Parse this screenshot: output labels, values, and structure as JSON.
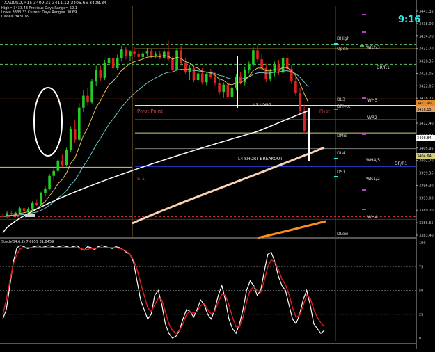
{
  "window": {
    "title": "XAUUSD,M15"
  },
  "header": {
    "ohlc": "XAUUSD,M15  3409.31 3411.12 3405.66 3408.84",
    "info_lines": [
      "High= 3433.43   Previous Days Range= 50.1",
      "Low= 3383.33   Current Days Range= 30.69",
      "Close= 3431.89"
    ]
  },
  "clock": "9:16",
  "colors": {
    "background": "#000000",
    "bull_candle": "#22cc22",
    "bear_candle": "#dd2222",
    "ema_fast": "#e8c04a",
    "ema_mid": "#6fc9c9",
    "ema_slow": "#ffffff",
    "ma_peach": "#f7d2b5",
    "ma_orange": "#ff8c1a",
    "stoch_main": "#ffffff",
    "stoch_signal": "#d81e1e",
    "current_price_tag": "#ff8c1a"
  },
  "price_axis": {
    "labels": [
      "3441.35",
      "3438.00",
      "3434.70",
      "3431.70",
      "3428.35",
      "3425.05",
      "3422.05",
      "3418.75",
      "3415.45",
      "3412.40",
      "3408.84",
      "3405.95",
      "3402.70",
      "3399.35",
      "3396.30",
      "3393.00",
      "3389.70",
      "3386.65",
      "3383.40"
    ],
    "tags": [
      "3417.90",
      "3416.15",
      "3404.64"
    ]
  },
  "stoch": {
    "label": "Stoch(34,6,2) 7.6659 31.8459",
    "levels": [
      "100",
      "75",
      "50",
      "25",
      "0"
    ]
  },
  "annotations": {
    "pivot_point": "Pivot Point",
    "s1": "S 1",
    "l3_long": "L3 LONG",
    "l4_short_breakout": "L4 SHORT BREAKOUT",
    "pivot": "Pivot"
  },
  "levels": {
    "dhigh": "DHigh",
    "open": "Open",
    "dl3": "DL3",
    "dpivot": "DPivot",
    "dmid": "DMid",
    "dl4": "DL4",
    "ds1": "DS1",
    "dlow": "DLow",
    "wr2_3": "WR2/3",
    "dr1": "DR/R1",
    "wh5": "WH5",
    "wr2": "WR2",
    "wh4_5": "WH4/5",
    "dpr1": "DP/R1",
    "wr1_2": "WR1/2",
    "wh4": "WH4"
  },
  "candles": [
    [
      3386.6,
      3387.2,
      3385.9,
      3386.4
    ],
    [
      3386.4,
      3387.8,
      3386.0,
      3387.3
    ],
    [
      3387.3,
      3388.0,
      3386.7,
      3387.0
    ],
    [
      3387.0,
      3387.6,
      3386.2,
      3387.4
    ],
    [
      3387.4,
      3389.1,
      3387.0,
      3388.6
    ],
    [
      3388.6,
      3389.3,
      3387.4,
      3387.9
    ],
    [
      3387.9,
      3388.8,
      3387.3,
      3388.5
    ],
    [
      3388.5,
      3390.5,
      3388.2,
      3390.0
    ],
    [
      3390.0,
      3391.0,
      3389.2,
      3389.6
    ],
    [
      3389.6,
      3393.0,
      3389.2,
      3392.6
    ],
    [
      3392.6,
      3394.4,
      3391.7,
      3393.9
    ],
    [
      3393.9,
      3397.8,
      3393.4,
      3397.3
    ],
    [
      3397.3,
      3399.2,
      3396.0,
      3398.6
    ],
    [
      3398.6,
      3402.0,
      3398.0,
      3401.4
    ],
    [
      3401.4,
      3403.0,
      3399.6,
      3400.2
    ],
    [
      3400.2,
      3404.8,
      3399.8,
      3404.2
    ],
    [
      3404.2,
      3410.6,
      3403.6,
      3409.8
    ],
    [
      3409.8,
      3412.2,
      3406.0,
      3407.0
    ],
    [
      3407.0,
      3416.8,
      3406.6,
      3415.6
    ],
    [
      3415.6,
      3420.4,
      3414.4,
      3418.8
    ],
    [
      3418.8,
      3421.0,
      3416.2,
      3417.0
    ],
    [
      3417.0,
      3423.2,
      3416.6,
      3422.6
    ],
    [
      3422.6,
      3426.8,
      3421.4,
      3425.6
    ],
    [
      3425.6,
      3427.0,
      3422.8,
      3423.6
    ],
    [
      3423.6,
      3428.4,
      3423.0,
      3427.6
    ],
    [
      3427.6,
      3430.0,
      3426.4,
      3428.8
    ],
    [
      3428.8,
      3429.6,
      3425.4,
      3426.2
    ],
    [
      3426.2,
      3429.8,
      3425.8,
      3428.9
    ],
    [
      3428.9,
      3432.2,
      3428.0,
      3431.2
    ],
    [
      3431.2,
      3432.0,
      3428.6,
      3429.4
    ],
    [
      3429.4,
      3431.0,
      3428.2,
      3430.6
    ],
    [
      3430.6,
      3431.8,
      3429.2,
      3430.0
    ],
    [
      3430.0,
      3431.0,
      3428.0,
      3429.2
    ],
    [
      3429.2,
      3430.8,
      3428.6,
      3430.2
    ],
    [
      3430.2,
      3431.6,
      3429.4,
      3430.8
    ],
    [
      3430.8,
      3431.4,
      3429.0,
      3429.6
    ],
    [
      3429.6,
      3430.6,
      3428.8,
      3430.0
    ],
    [
      3430.0,
      3430.8,
      3428.6,
      3429.0
    ],
    [
      3429.0,
      3431.2,
      3428.6,
      3430.6
    ],
    [
      3430.6,
      3433.6,
      3428.0,
      3428.6
    ],
    [
      3428.6,
      3429.4,
      3425.0,
      3425.8
    ],
    [
      3425.8,
      3431.6,
      3425.4,
      3431.0
    ],
    [
      3431.0,
      3432.2,
      3426.8,
      3427.6
    ],
    [
      3427.6,
      3429.0,
      3424.6,
      3425.2
    ],
    [
      3425.2,
      3427.0,
      3423.0,
      3426.2
    ],
    [
      3426.2,
      3427.0,
      3422.4,
      3423.0
    ],
    [
      3423.0,
      3425.6,
      3422.0,
      3424.8
    ],
    [
      3424.8,
      3426.2,
      3421.8,
      3422.4
    ],
    [
      3422.4,
      3425.2,
      3421.6,
      3424.6
    ],
    [
      3424.6,
      3426.0,
      3423.2,
      3423.8
    ],
    [
      3423.8,
      3425.0,
      3421.6,
      3422.2
    ],
    [
      3422.2,
      3423.6,
      3419.0,
      3419.8
    ],
    [
      3419.8,
      3422.4,
      3418.2,
      3421.8
    ],
    [
      3421.8,
      3423.2,
      3417.6,
      3418.4
    ],
    [
      3418.4,
      3421.6,
      3417.8,
      3421.0
    ],
    [
      3421.0,
      3424.6,
      3420.2,
      3424.0
    ],
    [
      3424.0,
      3425.2,
      3421.8,
      3422.4
    ],
    [
      3422.4,
      3426.6,
      3421.6,
      3425.8
    ],
    [
      3425.8,
      3428.0,
      3424.8,
      3427.2
    ],
    [
      3427.2,
      3431.8,
      3426.6,
      3431.0
    ],
    [
      3431.0,
      3432.6,
      3427.8,
      3428.6
    ],
    [
      3428.6,
      3430.2,
      3425.6,
      3426.2
    ],
    [
      3426.2,
      3427.4,
      3422.4,
      3423.2
    ],
    [
      3423.2,
      3426.0,
      3422.6,
      3425.2
    ],
    [
      3425.2,
      3428.0,
      3424.0,
      3427.2
    ],
    [
      3427.2,
      3428.4,
      3424.4,
      3425.0
    ],
    [
      3425.0,
      3429.6,
      3424.4,
      3429.0
    ],
    [
      3429.0,
      3430.0,
      3425.2,
      3426.0
    ],
    [
      3426.0,
      3427.0,
      3422.0,
      3422.8
    ],
    [
      3422.8,
      3424.2,
      3418.8,
      3419.6
    ],
    [
      3419.6,
      3421.0,
      3414.0,
      3414.8
    ],
    [
      3414.8,
      3416.4,
      3408.6,
      3409.4
    ],
    [
      3409.4,
      3411.1,
      3405.7,
      3408.8
    ]
  ]
}
